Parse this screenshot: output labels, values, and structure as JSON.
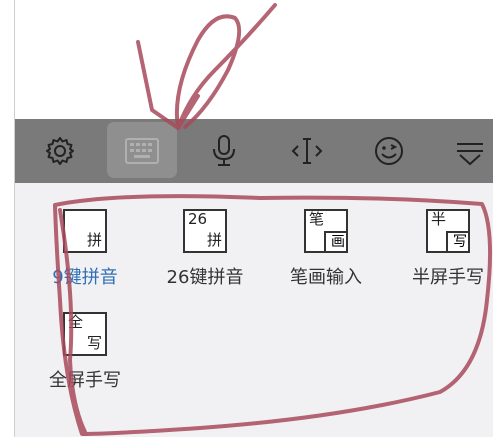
{
  "toolbar": {
    "items": [
      {
        "icon": "gear-icon"
      },
      {
        "icon": "keyboard-icon",
        "active": true
      },
      {
        "icon": "microphone-icon"
      },
      {
        "icon": "cursor-move-icon"
      },
      {
        "icon": "emoji-icon"
      },
      {
        "icon": "collapse-icon"
      }
    ]
  },
  "input_modes": [
    {
      "label": "9键拼音",
      "key_top": "",
      "key_bottom": "拼",
      "selected": true
    },
    {
      "label": "26键拼音",
      "key_top": "26",
      "key_bottom": "拼",
      "selected": false
    },
    {
      "label": "笔画输入",
      "key_top": "笔",
      "key_bottom": "画",
      "selected": false
    },
    {
      "label": "半屏手写",
      "key_top": "半",
      "key_bottom": "写",
      "selected": false
    },
    {
      "label": "全屏手写",
      "key_top": "全",
      "key_bottom": "写",
      "selected": false
    }
  ],
  "colors": {
    "toolbar_bg": "#7a7a7a",
    "panel_bg": "#f1f1f3",
    "selected_text": "#2f6fb5",
    "scribble": "#a84a5a"
  }
}
